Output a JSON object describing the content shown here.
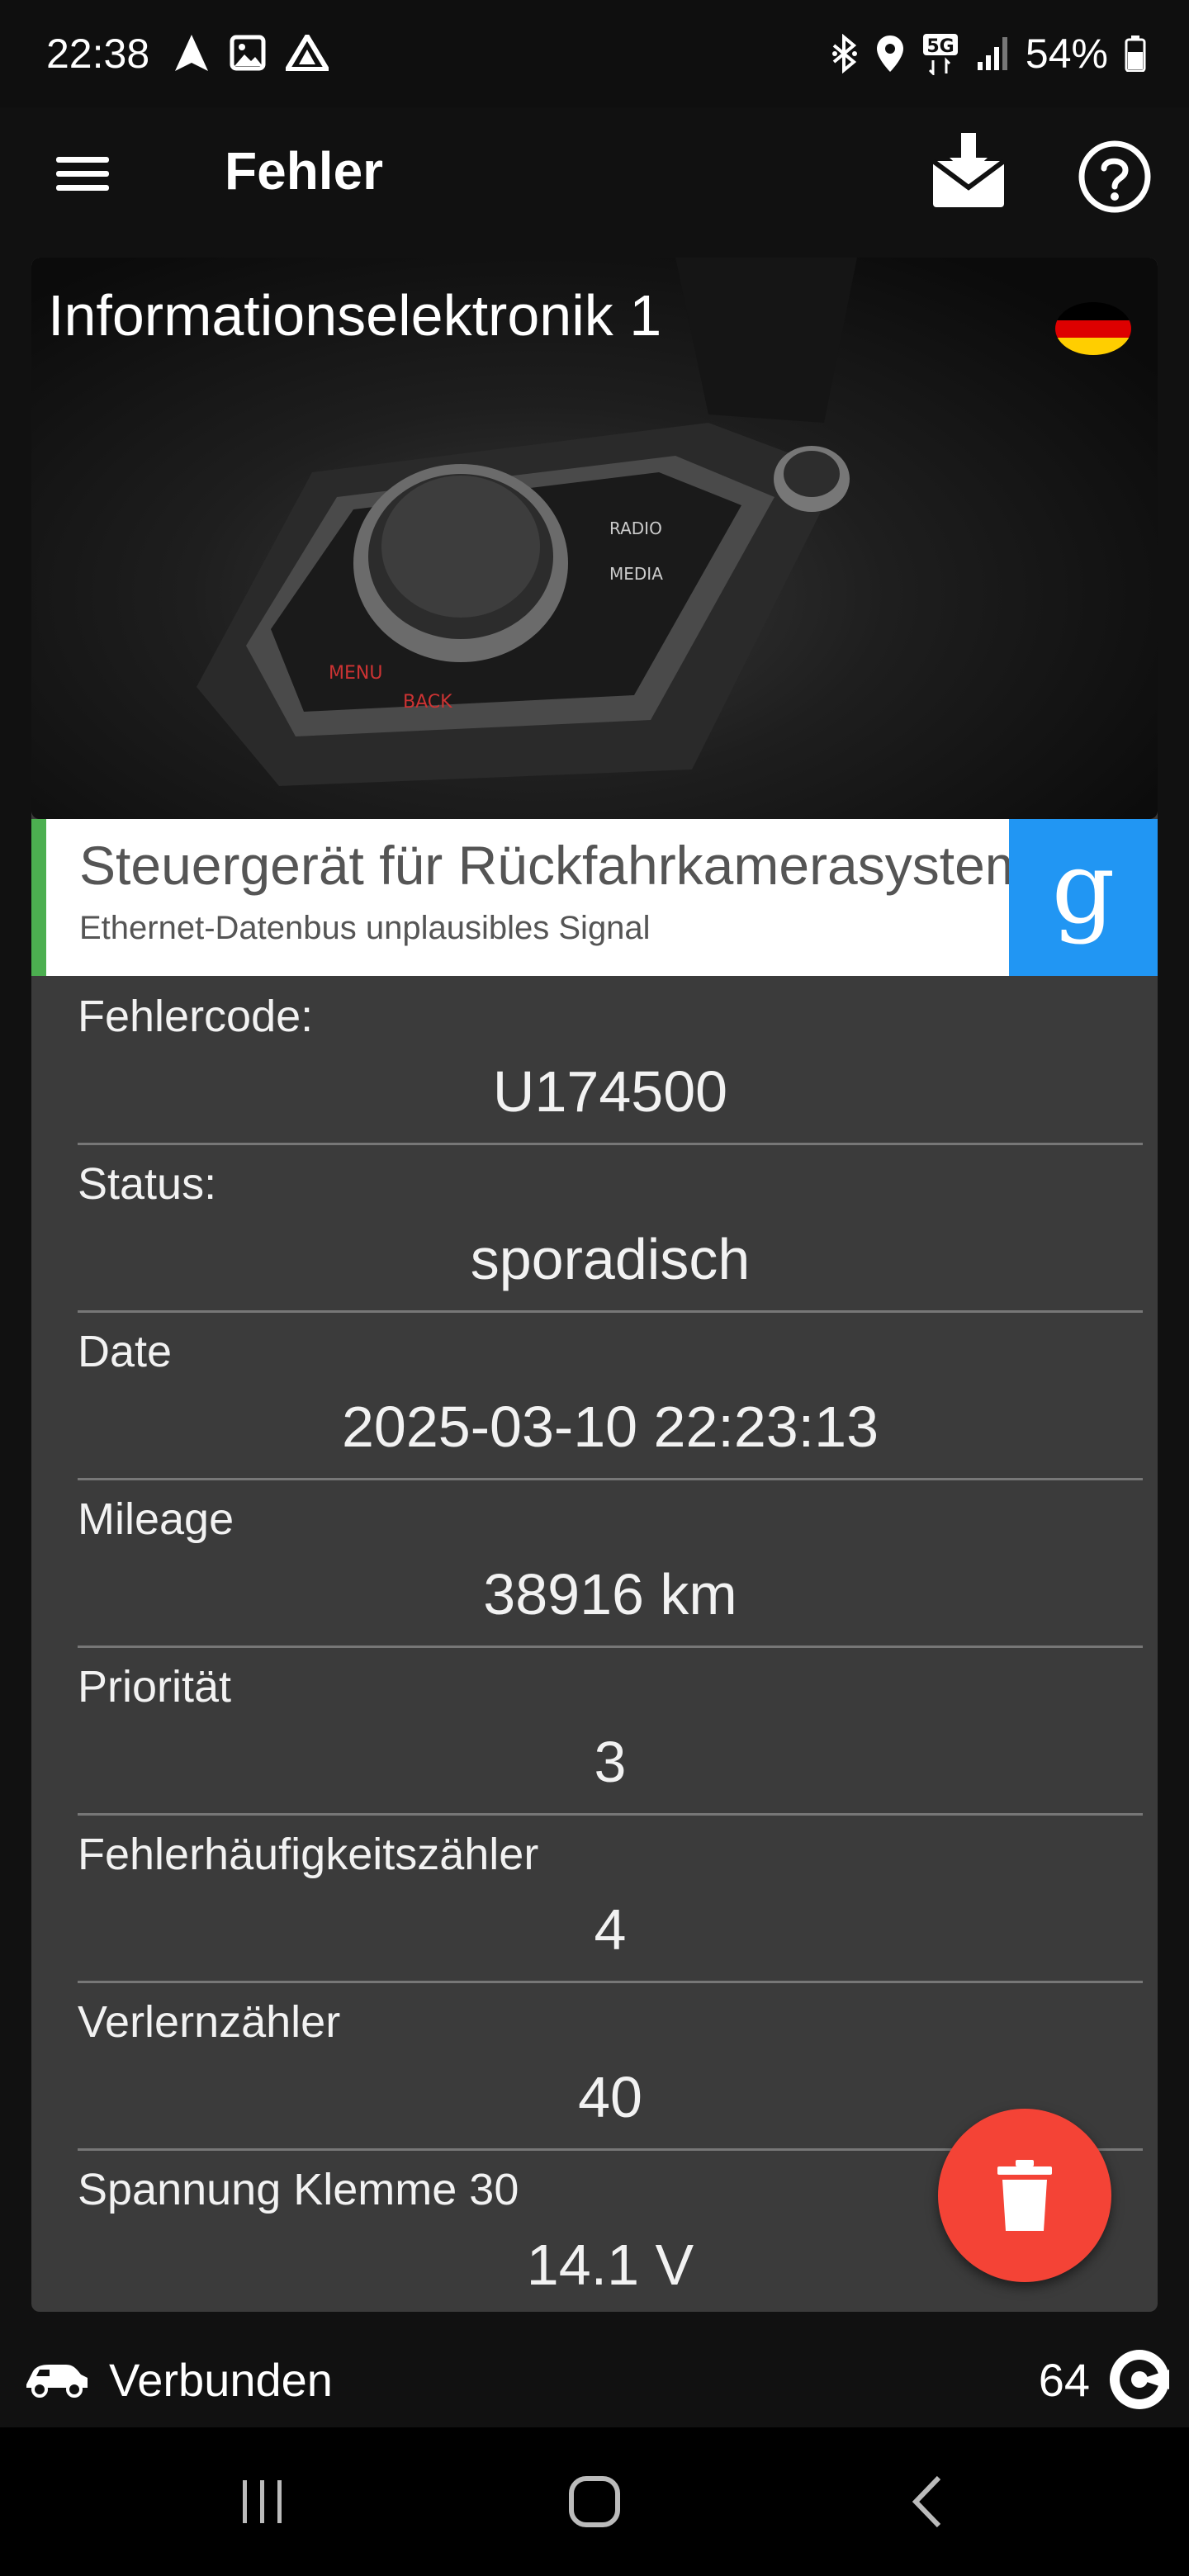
{
  "status_bar": {
    "time": "22:38",
    "battery": "54%",
    "left_icons": [
      "navigation-icon",
      "image-icon",
      "android-auto-icon"
    ],
    "right_icons": [
      "bluetooth-icon",
      "location-icon",
      "5g-icon",
      "signal-icon",
      "battery-icon"
    ]
  },
  "app_bar": {
    "title": "Fehler",
    "icons": [
      "menu-icon",
      "inbox-download-icon",
      "help-icon"
    ]
  },
  "card": {
    "module_title": "Informationselektronik 1",
    "flag_icon": "germany-flag-icon",
    "device_name": "Steuergerät für Rückfahrkamerasystem",
    "device_description": "Ethernet-Datenbus unplausibles Signal",
    "google_label": "g",
    "fields": [
      {
        "label": "Fehlercode:",
        "value": "U174500"
      },
      {
        "label": "Status:",
        "value": "sporadisch"
      },
      {
        "label": "Date",
        "value": "2025-03-10 22:23:13"
      },
      {
        "label": "Mileage",
        "value": "38916 km"
      },
      {
        "label": "Priorität",
        "value": "3"
      },
      {
        "label": "Fehlerhäufigkeitszähler",
        "value": "4"
      },
      {
        "label": "Verlernzähler",
        "value": "40"
      },
      {
        "label": "Spannung Klemme 30",
        "value": "14.1 V"
      }
    ]
  },
  "fab_icon": "trash-icon",
  "connection": {
    "status": "Verbunden",
    "count": "64"
  },
  "colors": {
    "background": "#111111",
    "card": "#3b3b3b",
    "accent_green": "#4caf50",
    "google_blue": "#2196f3",
    "fab_red": "#f44336"
  }
}
